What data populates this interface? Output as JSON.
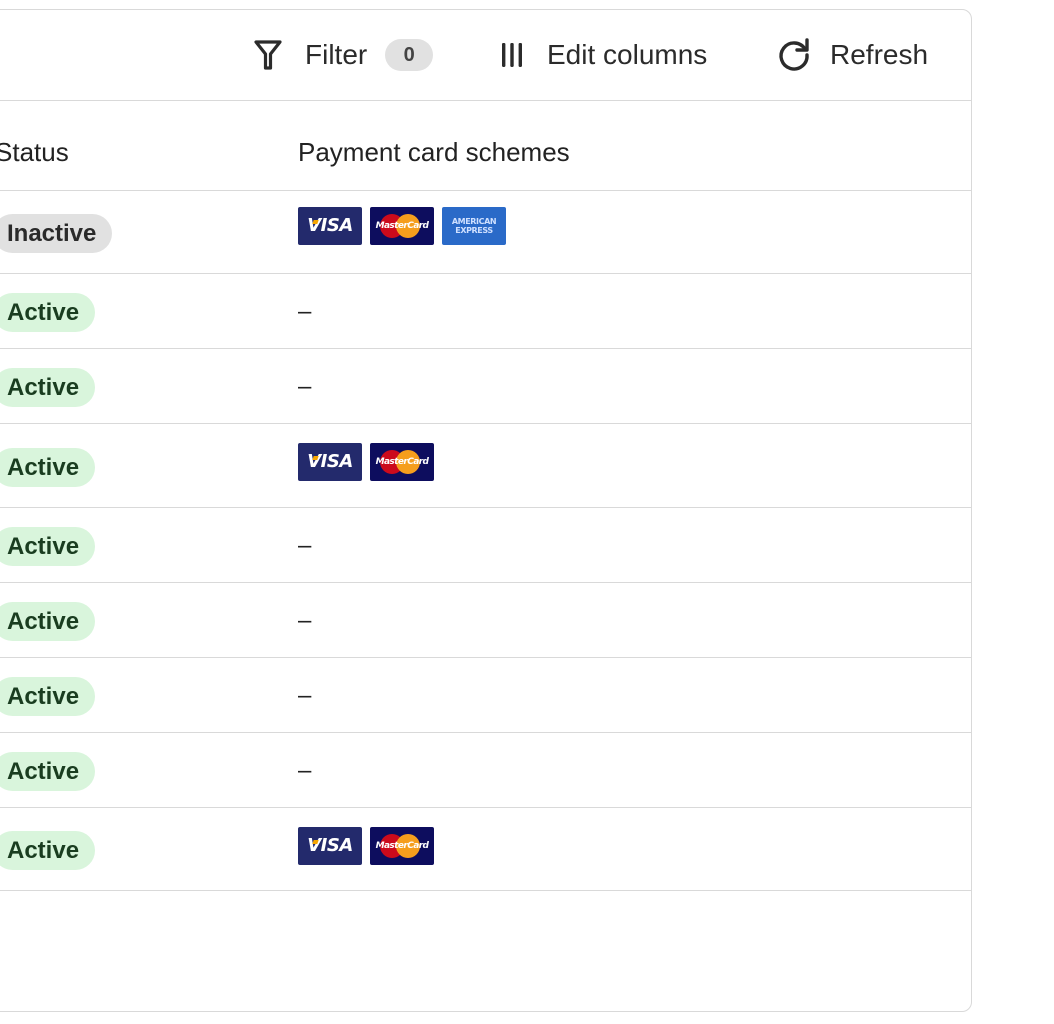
{
  "toolbar": {
    "filter_label": "Filter",
    "filter_count": "0",
    "edit_columns_label": "Edit columns",
    "refresh_label": "Refresh"
  },
  "table": {
    "headers": {
      "status": "Status",
      "payment_card_schemes": "Payment card schemes"
    },
    "rows": [
      {
        "status": "Inactive",
        "status_type": "inactive",
        "schemes": [
          "visa",
          "mastercard",
          "amex"
        ]
      },
      {
        "status": "Active",
        "status_type": "active",
        "schemes": []
      },
      {
        "status": "Active",
        "status_type": "active",
        "schemes": []
      },
      {
        "status": "Active",
        "status_type": "active",
        "schemes": [
          "visa",
          "mastercard"
        ]
      },
      {
        "status": "Active",
        "status_type": "active",
        "schemes": []
      },
      {
        "status": "Active",
        "status_type": "active",
        "schemes": []
      },
      {
        "status": "Active",
        "status_type": "active",
        "schemes": []
      },
      {
        "status": "Active",
        "status_type": "active",
        "schemes": []
      },
      {
        "status": "Active",
        "status_type": "active",
        "schemes": [
          "visa",
          "mastercard"
        ]
      }
    ],
    "empty_value": "–"
  },
  "card_labels": {
    "visa": "VISA",
    "mastercard": "MasterCard",
    "amex_line1": "AMERICAN",
    "amex_line2": "EXPRESS"
  },
  "colors": {
    "active_badge_bg": "#d9f5dc",
    "active_badge_text": "#1a3d20",
    "inactive_badge_bg": "#e1e1e1",
    "visa_bg": "#232a6c",
    "mastercard_bg": "#0d0d5e",
    "amex_bg": "#2a6ac8"
  }
}
